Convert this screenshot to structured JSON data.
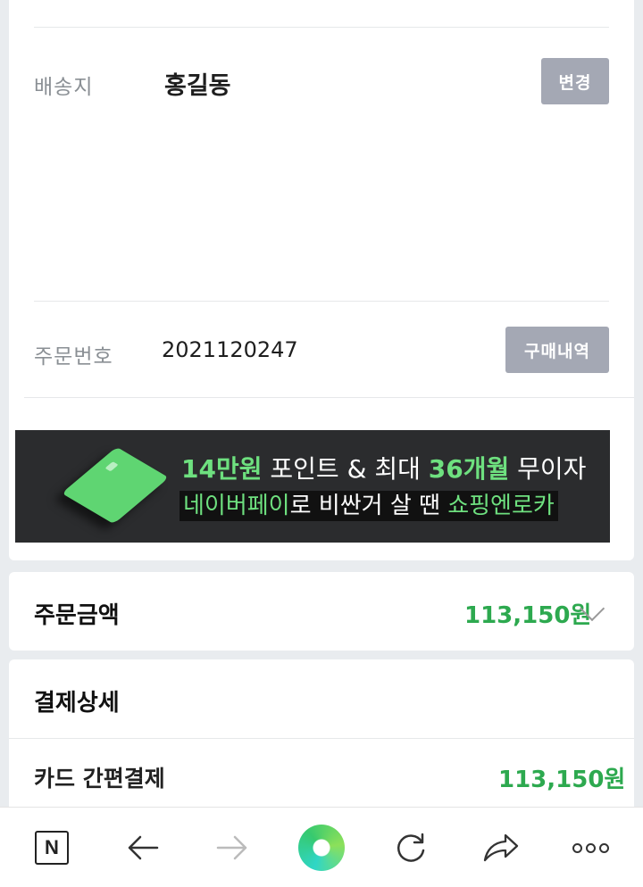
{
  "shipping": {
    "label": "배송지",
    "name": "홍길동",
    "change_button": "변경"
  },
  "order": {
    "label": "주문번호",
    "number": "2021120247",
    "history_button": "구매내역"
  },
  "banner": {
    "line1_part1": "14만원",
    "line1_part2": " 포인트 & 최대 ",
    "line1_part3": "36개월",
    "line1_part4": " 무이자",
    "line2_part1": "네이버페이",
    "line2_part2": "로 비싼거 살 땐 ",
    "line2_part3": "쇼핑엔로카",
    "card_color": "#5fd572"
  },
  "order_amount": {
    "title": "주문금액",
    "value": "113,150원"
  },
  "payment_detail": {
    "title": "결제상세",
    "method_label": "카드 간편결제",
    "method_value": "113,150원"
  },
  "toolbar": {
    "naver_label": "N",
    "icons": [
      "naver-home-icon",
      "back-arrow-icon",
      "forward-arrow-icon",
      "green-dot-button",
      "refresh-icon",
      "share-icon",
      "more-icon"
    ]
  },
  "colors": {
    "accent_green": "#2da94f",
    "button_gray": "#a4a8b4",
    "background": "#e9ecef"
  }
}
